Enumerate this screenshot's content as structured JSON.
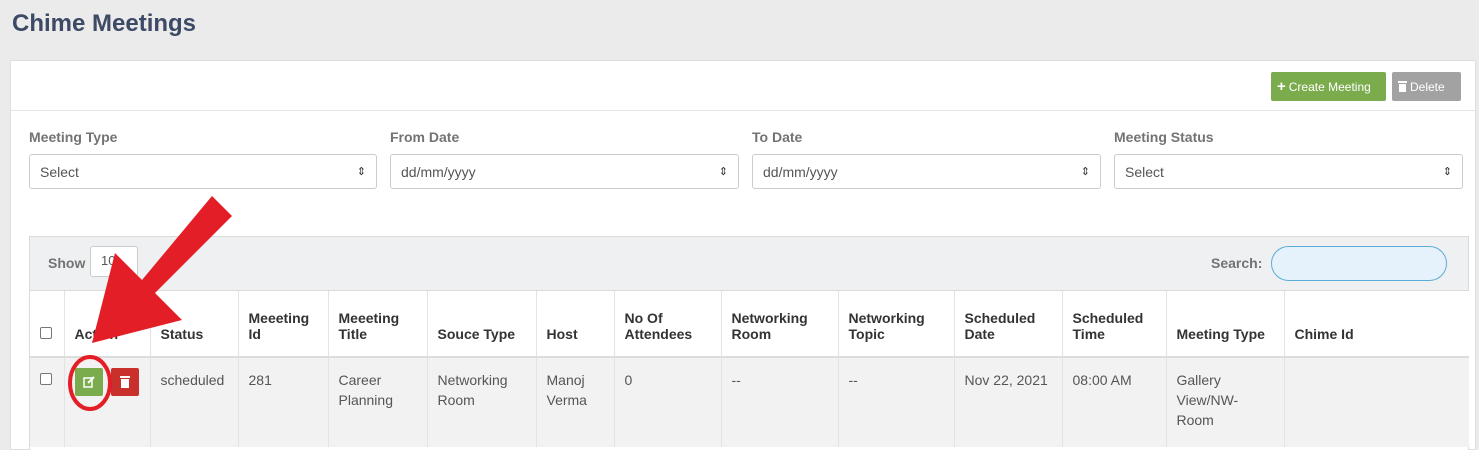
{
  "page": {
    "title": "Chime Meetings"
  },
  "toolbar": {
    "create_label": "Create Meeting",
    "delete_label": "Delete"
  },
  "filters": [
    {
      "label": "Meeting Type",
      "value": "Select"
    },
    {
      "label": "From Date",
      "value": "dd/mm/yyyy"
    },
    {
      "label": "To Date",
      "value": "dd/mm/yyyy"
    },
    {
      "label": "Meeting Status",
      "value": "Select"
    }
  ],
  "table_controls": {
    "show_label": "Show",
    "show_value": "10",
    "search_label": "Search:"
  },
  "table": {
    "columns": [
      "Action",
      "Status",
      "Meeeting Id",
      "Meeeting Title",
      "Souce Type",
      "Host",
      "No Of Attendees",
      "Networking Room",
      "Networking Topic",
      "Scheduled Date",
      "Scheduled Time",
      "Meeting Type",
      "Chime Id"
    ],
    "rows": [
      {
        "status": "scheduled",
        "id": "281",
        "title": "Career Planning",
        "source": "Networking Room",
        "host": "Manoj Verma",
        "attendees": "0",
        "room": "--",
        "topic": "--",
        "date": "Nov 22, 2021",
        "time": "08:00 AM",
        "type": "Gallery View/NW-Room",
        "chime_id": ""
      }
    ]
  },
  "colors": {
    "accent_green": "#7aab4c",
    "danger_red": "#c9302c",
    "annotation_red": "#e41e26",
    "title_navy": "#3d4a66"
  },
  "icons": [
    "plus-icon",
    "trash-icon",
    "select-arrows-icon",
    "edit-icon",
    "annotation-arrow",
    "annotation-circle"
  ]
}
